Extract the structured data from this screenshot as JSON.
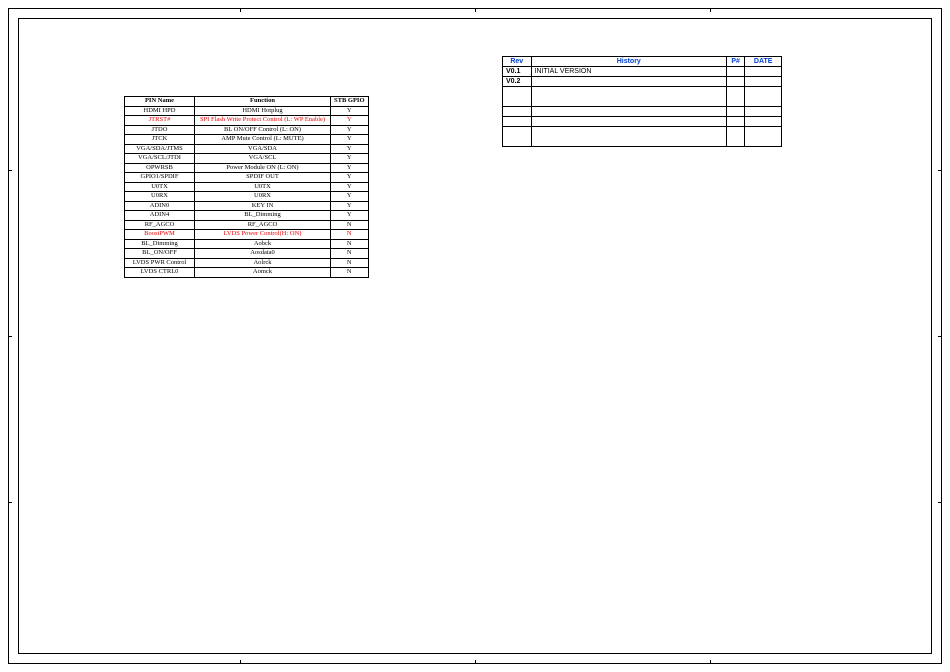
{
  "pin_table": {
    "headers": {
      "pin": "PIN Name",
      "func": "Function",
      "stb": "STB GPIO"
    },
    "rows": [
      {
        "pin": "HDMI HPD",
        "func": "HDMI Hotplug",
        "stb": "Y",
        "red": false
      },
      {
        "pin": "JTRST#",
        "func": "SPI Flash Write Protect Control (L: WP Enable)",
        "stb": "Y",
        "red": true
      },
      {
        "pin": "JTDO",
        "func": "BL ON/OFF Control (L: ON)",
        "stb": "Y",
        "red": false
      },
      {
        "pin": "JTCK",
        "func": "AMP Mute Control (L: MUTE)",
        "stb": "Y",
        "red": false
      },
      {
        "pin": "VGA/SDA/JTMS",
        "func": "VGA/SDA",
        "stb": "Y",
        "red": false
      },
      {
        "pin": "VGA/SCL/JTDI",
        "func": "VGA/SCL",
        "stb": "Y",
        "red": false
      },
      {
        "pin": "OPWRSB",
        "func": "Power Module ON (L: ON)",
        "stb": "Y",
        "red": false
      },
      {
        "pin": "GPIO1/SPDIF",
        "func": "SPDIF OUT",
        "stb": "Y",
        "red": false
      },
      {
        "pin": "U0TX",
        "func": "U0TX",
        "stb": "Y",
        "red": false
      },
      {
        "pin": "U0RX",
        "func": "U0RX",
        "stb": "Y",
        "red": false
      },
      {
        "pin": "ADIN0",
        "func": "KEY IN",
        "stb": "Y",
        "red": false
      },
      {
        "pin": "ADIN4",
        "func": "BL_Dimming",
        "stb": "Y",
        "red": false
      },
      {
        "pin": "RF_AGCO",
        "func": "RF_AGCO",
        "stb": "N",
        "red": false
      },
      {
        "pin": "BoostPWM",
        "func": "LVDS Power Control(H: ON)",
        "stb": "N",
        "red": true
      },
      {
        "pin": "BL_Dimming",
        "func": "Aobck",
        "stb": "N",
        "red": false
      },
      {
        "pin": "BL_ON/OFF",
        "func": "Aosdata0",
        "stb": "N",
        "red": false
      },
      {
        "pin": "LVDS PWR Control",
        "func": "Aolrck",
        "stb": "N",
        "red": false
      },
      {
        "pin": "LVDS CTRL0",
        "func": "Aomck",
        "stb": "N",
        "red": false
      }
    ]
  },
  "rev_block": {
    "headers": {
      "rev": "Rev",
      "hist": "History",
      "p": "P#",
      "date": "DATE"
    },
    "rows": [
      {
        "rev": "V0.1",
        "hist": "INITIAL VERSION",
        "p": "",
        "date": "",
        "tall": false
      },
      {
        "rev": "V0.2",
        "hist": "",
        "p": "",
        "date": "",
        "tall": false
      },
      {
        "rev": "",
        "hist": "",
        "p": "",
        "date": "",
        "tall": true
      },
      {
        "rev": "",
        "hist": "",
        "p": "",
        "date": "",
        "tall": false
      },
      {
        "rev": "",
        "hist": "",
        "p": "",
        "date": "",
        "tall": false
      },
      {
        "rev": "",
        "hist": "",
        "p": "",
        "date": "",
        "tall": true
      }
    ]
  }
}
